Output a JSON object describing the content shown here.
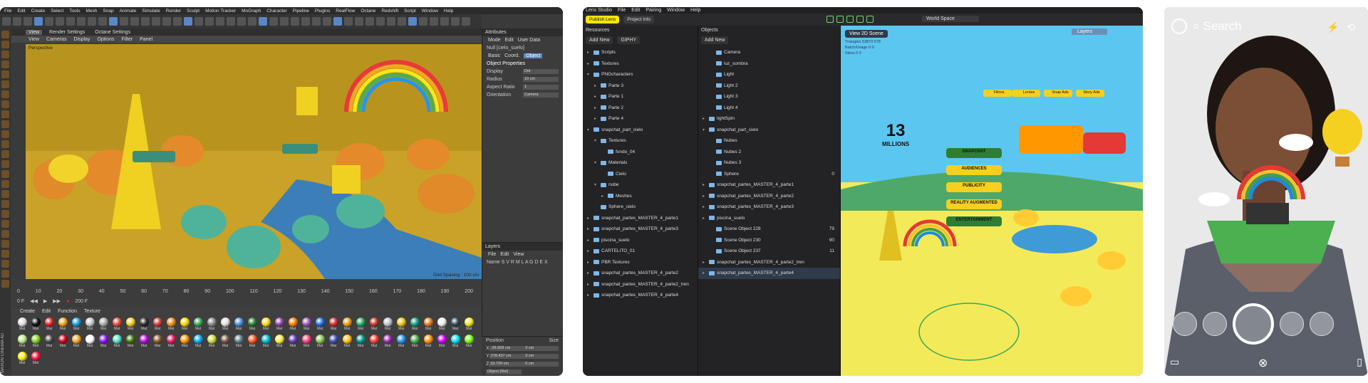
{
  "c4d": {
    "menu": [
      "File",
      "Edit",
      "Create",
      "Select",
      "Tools",
      "Mesh",
      "Snap",
      "Animate",
      "Simulate",
      "Render",
      "Sculpt",
      "Motion Tracker",
      "MoGraph",
      "Character",
      "Pipeline",
      "Plugins",
      "RealFlow",
      "Octane",
      "Redshift",
      "Script",
      "Window",
      "Help"
    ],
    "viewport_tabs": [
      "View",
      "Render Settings",
      "Octane Settings"
    ],
    "viewport_menu": [
      "View",
      "Cameras",
      "Display",
      "Options",
      "Filter",
      "Panel"
    ],
    "viewport_label": "Perspective",
    "grid_spacing": "Grid Spacing : 100 cm",
    "ruler": [
      "0",
      "10",
      "20",
      "30",
      "40",
      "50",
      "60",
      "70",
      "80",
      "90",
      "100",
      "110",
      "120",
      "130",
      "140",
      "150",
      "160",
      "170",
      "180",
      "190",
      "200"
    ],
    "frame_start": "0 F",
    "frame_end": "200 F",
    "material_menu": [
      "Create",
      "Edit",
      "Function",
      "Texture"
    ],
    "material_label": "Mat",
    "material_colors": [
      "#dddddd",
      "#111111",
      "#e8232c",
      "#f1a420",
      "#1d9fd8",
      "#c8c8c8",
      "#aaaaaa",
      "#e74c3c",
      "#f5d020",
      "#2c2c2c",
      "#d23b3b",
      "#f28d1a",
      "#ffd500",
      "#3aa757",
      "#888888",
      "#e0e0e0",
      "#4a90e2",
      "#2e7d32",
      "#f9d71c",
      "#8e44ad",
      "#ff7f00",
      "#9b59b6",
      "#1a73e8",
      "#d32f2f",
      "#f39c12",
      "#27ae60",
      "#c0392b",
      "#bdc3c7",
      "#f1c40f",
      "#16a085",
      "#e67e22",
      "#ecf0f1",
      "#34495e",
      "#f8e71c",
      "#b8e986",
      "#7ed321",
      "#4a4a4a",
      "#d0021b",
      "#f5a623",
      "#ffffff",
      "#9013fe",
      "#50e3c2",
      "#417505",
      "#bd10e0",
      "#8b572a",
      "#e91e63",
      "#ff9800",
      "#03a9f4",
      "#cddc39",
      "#795548",
      "#607d8b",
      "#ff5722",
      "#00bcd4",
      "#ffeb3b",
      "#673ab7",
      "#ff4081",
      "#8bc34a",
      "#3f51b5",
      "#ffc107",
      "#009688",
      "#f44336",
      "#9c27b0",
      "#2196f3",
      "#4caf50",
      "#ff9100",
      "#d500f9",
      "#00e5ff",
      "#76ff03",
      "#ffea00",
      "#ff1744"
    ],
    "attributes_title": "Attributes",
    "attributes_menu": [
      "Mode",
      "Edit",
      "User Data"
    ],
    "object_name": "Null [cielo_suelo]",
    "attr_tabs": [
      "Basic",
      "Coord.",
      "Object"
    ],
    "object_properties": "Object Properties",
    "props": [
      {
        "k": "Display",
        "v": "Dot"
      },
      {
        "k": "Radius",
        "v": "10 cm"
      },
      {
        "k": "Aspect Ratio",
        "v": "1"
      },
      {
        "k": "Orientation",
        "v": "Camera"
      }
    ],
    "layers_title": "Layers",
    "layers_menu": [
      "File",
      "Edit",
      "View"
    ],
    "layers_cols": "Name  S V R M L A G D E X",
    "coord_headers": [
      "Position",
      "Size"
    ],
    "coords": [
      {
        "axis": "X",
        "pos": "-26.909 cm",
        "size": "0 cm"
      },
      {
        "axis": "Y",
        "pos": "278.437 cm",
        "size": "0 cm"
      },
      {
        "axis": "Z",
        "pos": "33.709 cm",
        "size": "0 cm"
      }
    ],
    "coord_mode": "Object (Rel)",
    "side_label": "MAXON CINEMA 4D"
  },
  "lens": {
    "menu": [
      "Lens Studio",
      "File",
      "Edit",
      "Pairing",
      "Window",
      "Help"
    ],
    "publish": "Publish Lens",
    "project_info": "Project Info",
    "world_space": "World Space",
    "resources_title": "Resources",
    "add_new": "Add New",
    "giphy": "GIPHY",
    "resources": [
      {
        "label": "Scripts",
        "indent": 0,
        "caret": "▸"
      },
      {
        "label": "Textures",
        "indent": 0,
        "caret": "▸"
      },
      {
        "label": "PNGcharacters",
        "indent": 0,
        "caret": "▾"
      },
      {
        "label": "Parte 3",
        "indent": 1,
        "caret": "▸"
      },
      {
        "label": "Parte 1",
        "indent": 1,
        "caret": "▸"
      },
      {
        "label": "Parte 2",
        "indent": 1,
        "caret": "▸"
      },
      {
        "label": "Parte 4",
        "indent": 1,
        "caret": "▸"
      },
      {
        "label": "snapchat_part_cielo",
        "indent": 0,
        "caret": "▾"
      },
      {
        "label": "Textures",
        "indent": 1,
        "caret": "▾"
      },
      {
        "label": "fondo_04",
        "indent": 2,
        "caret": ""
      },
      {
        "label": "Materials",
        "indent": 1,
        "caret": "▾"
      },
      {
        "label": "Cielo",
        "indent": 2,
        "caret": ""
      },
      {
        "label": "nube",
        "indent": 1,
        "caret": "▾"
      },
      {
        "label": "Meshes",
        "indent": 2,
        "caret": "▸"
      },
      {
        "label": "Sphere_cielo",
        "indent": 1,
        "caret": ""
      },
      {
        "label": "snapchat_partes_MASTER_4_parte1",
        "indent": 0,
        "caret": "▸"
      },
      {
        "label": "snapchat_partes_MASTER_4_parte3",
        "indent": 0,
        "caret": "▸"
      },
      {
        "label": "piscina_suelo",
        "indent": 0,
        "caret": "▸"
      },
      {
        "label": "CARTELITO_01",
        "indent": 0,
        "caret": "▸"
      },
      {
        "label": "PBR Textures",
        "indent": 0,
        "caret": "▸"
      },
      {
        "label": "snapchat_partes_MASTER_4_parte2",
        "indent": 0,
        "caret": "▸"
      },
      {
        "label": "snapchat_partes_MASTER_4_parte2_tren",
        "indent": 0,
        "caret": "▸"
      },
      {
        "label": "snapchat_partes_MASTER_4_parte4",
        "indent": 0,
        "caret": "▸"
      }
    ],
    "objects_title": "Objects",
    "objects": [
      {
        "label": "Camera",
        "indent": 1,
        "caret": "",
        "n": ""
      },
      {
        "label": "luz_sombra",
        "indent": 1,
        "caret": "",
        "n": ""
      },
      {
        "label": "Light",
        "indent": 1,
        "caret": "",
        "n": ""
      },
      {
        "label": "Light 2",
        "indent": 1,
        "caret": "",
        "n": ""
      },
      {
        "label": "Light 3",
        "indent": 1,
        "caret": "",
        "n": ""
      },
      {
        "label": "Light 4",
        "indent": 1,
        "caret": "",
        "n": ""
      },
      {
        "label": "lightSpin",
        "indent": 0,
        "caret": "▸",
        "n": ""
      },
      {
        "label": "snapchat_part_cielo",
        "indent": 0,
        "caret": "▾",
        "n": ""
      },
      {
        "label": "Nubes",
        "indent": 1,
        "caret": "",
        "n": ""
      },
      {
        "label": "Nubes 2",
        "indent": 1,
        "caret": "",
        "n": ""
      },
      {
        "label": "Nubes 3",
        "indent": 1,
        "caret": "",
        "n": ""
      },
      {
        "label": "Sphere",
        "indent": 1,
        "caret": "",
        "n": "0"
      },
      {
        "label": "snapchat_partes_MASTER_4_parte1",
        "indent": 0,
        "caret": "▸",
        "n": ""
      },
      {
        "label": "snapchat_partes_MASTER_4_parte2",
        "indent": 0,
        "caret": "▸",
        "n": ""
      },
      {
        "label": "snapchat_partes_MASTER_4_parte3",
        "indent": 0,
        "caret": "▸",
        "n": ""
      },
      {
        "label": "piscina_suelo",
        "indent": 0,
        "caret": "▸",
        "n": ""
      },
      {
        "label": "Scene Object 228",
        "indent": 1,
        "caret": "",
        "n": "79"
      },
      {
        "label": "Scene Object 230",
        "indent": 1,
        "caret": "",
        "n": "90"
      },
      {
        "label": "Scene Object 237",
        "indent": 1,
        "caret": "",
        "n": "11"
      },
      {
        "label": "snapchat_partes_MASTER_4_parte2_tren",
        "indent": 0,
        "caret": "▸",
        "n": ""
      },
      {
        "label": "snapchat_partes_MASTER_4_parte4",
        "indent": 0,
        "caret": "▸",
        "n": "",
        "sel": true
      }
    ],
    "view_badge": "View 2D Scene",
    "layers_btn": "Layers",
    "stats": [
      "Triangles  53873  578",
      "Batch/Usage  0  0",
      "Skins  0  0"
    ],
    "big_number": "13",
    "big_unit": "MILLIONS",
    "scene_tags": [
      "Filtros",
      "Lentes",
      "Snap Ads",
      "Story Ads"
    ],
    "scene_signs": [
      "SNAPCHAT",
      "AUDIENCES",
      "PUBLICITY",
      "REALITY AUGMENTED",
      "ENTERTAINMENT"
    ]
  },
  "snap": {
    "search": "Search"
  }
}
